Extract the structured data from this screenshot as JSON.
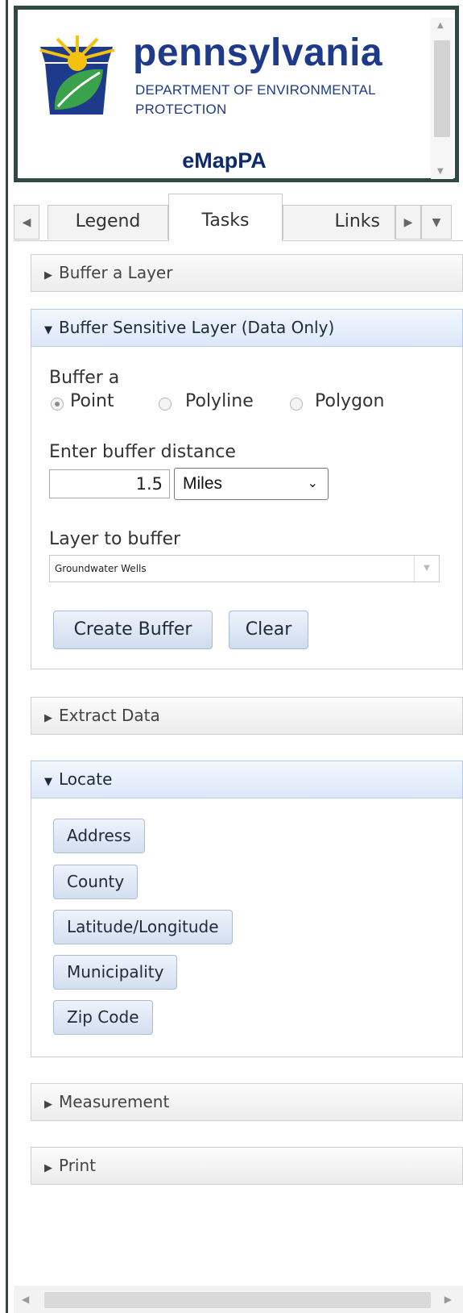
{
  "header": {
    "brand": "pennsylvania",
    "department_line1": "DEPARTMENT OF ENVIRONMENTAL",
    "department_line2": "PROTECTION",
    "app_name": "eMapPA",
    "logo_icon": "keystone-leaf-logo-icon"
  },
  "tabs": {
    "items": [
      {
        "label": "Legend",
        "active": false
      },
      {
        "label": "Tasks",
        "active": true
      },
      {
        "label": "Links",
        "active": false
      }
    ]
  },
  "sections": {
    "buffer_layer": {
      "title": "Buffer a Layer",
      "expanded": false
    },
    "buffer_sensitive": {
      "title": "Buffer Sensitive Layer (Data Only)",
      "expanded": true,
      "buffer_a_label": "Buffer a",
      "geometry_options": [
        {
          "label": "Point",
          "selected": true
        },
        {
          "label": "Polyline",
          "selected": false
        },
        {
          "label": "Polygon",
          "selected": false
        }
      ],
      "distance_label": "Enter buffer distance",
      "distance_value": "1.5",
      "unit_selected": "Miles",
      "layer_label": "Layer to buffer",
      "layer_selected": "Groundwater Wells",
      "create_button": "Create Buffer",
      "clear_button": "Clear"
    },
    "extract_data": {
      "title": "Extract Data",
      "expanded": false
    },
    "locate": {
      "title": "Locate",
      "expanded": true,
      "buttons": [
        "Address",
        "County",
        "Latitude/Longitude",
        "Municipality",
        "Zip Code"
      ]
    },
    "measurement": {
      "title": "Measurement",
      "expanded": false
    },
    "print": {
      "title": "Print",
      "expanded": false
    }
  },
  "colors": {
    "brand_blue": "#1e3a8a",
    "frame_border": "#2f4a45",
    "button_gradient_top": "#eef3fb",
    "button_gradient_bottom": "#cfdcef"
  }
}
